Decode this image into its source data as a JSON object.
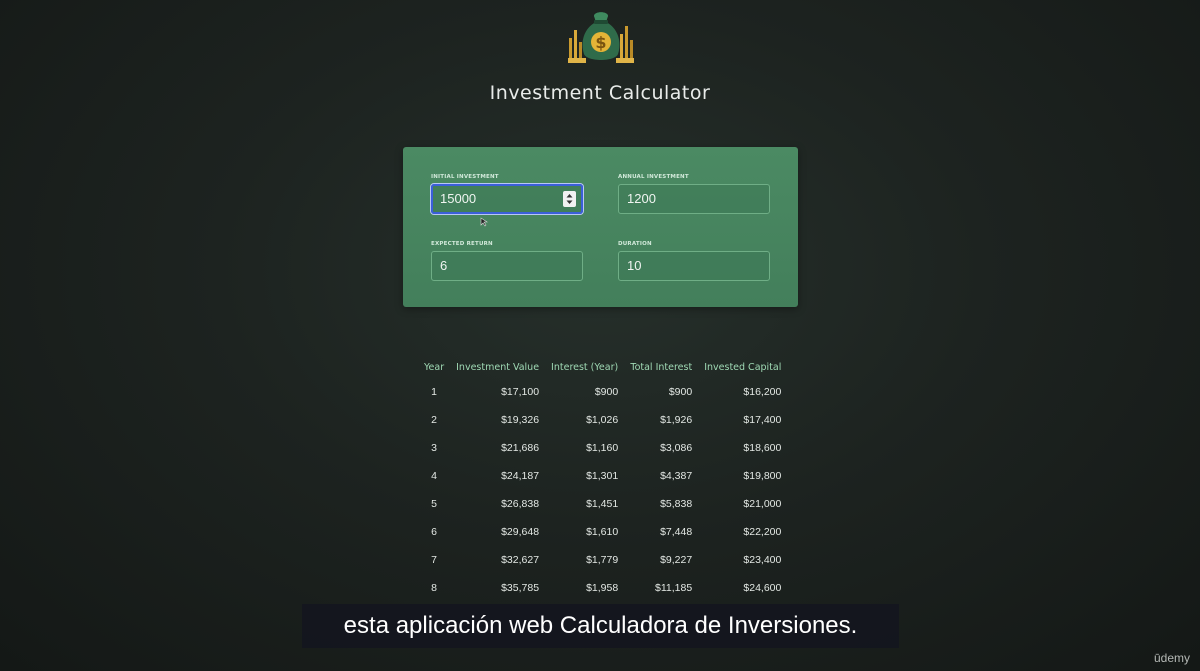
{
  "app": {
    "title": "Investment Calculator",
    "logo_icon": "money-bag-icon"
  },
  "form": {
    "initial_investment": {
      "label": "INITIAL INVESTMENT",
      "value": "15000"
    },
    "annual_investment": {
      "label": "ANNUAL INVESTMENT",
      "value": "1200"
    },
    "expected_return": {
      "label": "EXPECTED RETURN",
      "value": "6"
    },
    "duration": {
      "label": "DURATION",
      "value": "10"
    }
  },
  "results": {
    "headers": {
      "year": "Year",
      "investment_value": "Investment Value",
      "interest_year": "Interest (Year)",
      "total_interest": "Total Interest",
      "invested_capital": "Invested Capital"
    },
    "rows": [
      {
        "year": "1",
        "investment_value": "$17,100",
        "interest_year": "$900",
        "total_interest": "$900",
        "invested_capital": "$16,200"
      },
      {
        "year": "2",
        "investment_value": "$19,326",
        "interest_year": "$1,026",
        "total_interest": "$1,926",
        "invested_capital": "$17,400"
      },
      {
        "year": "3",
        "investment_value": "$21,686",
        "interest_year": "$1,160",
        "total_interest": "$3,086",
        "invested_capital": "$18,600"
      },
      {
        "year": "4",
        "investment_value": "$24,187",
        "interest_year": "$1,301",
        "total_interest": "$4,387",
        "invested_capital": "$19,800"
      },
      {
        "year": "5",
        "investment_value": "$26,838",
        "interest_year": "$1,451",
        "total_interest": "$5,838",
        "invested_capital": "$21,000"
      },
      {
        "year": "6",
        "investment_value": "$29,648",
        "interest_year": "$1,610",
        "total_interest": "$7,448",
        "invested_capital": "$22,200"
      },
      {
        "year": "7",
        "investment_value": "$32,627",
        "interest_year": "$1,779",
        "total_interest": "$9,227",
        "invested_capital": "$23,400"
      },
      {
        "year": "8",
        "investment_value": "$35,785",
        "interest_year": "$1,958",
        "total_interest": "$11,185",
        "invested_capital": "$24,600"
      }
    ]
  },
  "overlay": {
    "subtitle": "esta aplicación web Calculadora de Inversiones.",
    "watermark": "ūdemy"
  },
  "colors": {
    "background": "#1d2320",
    "card": "#4b8a63",
    "header_text": "#9fd9b4",
    "focus_ring": "#3b5fd9"
  }
}
